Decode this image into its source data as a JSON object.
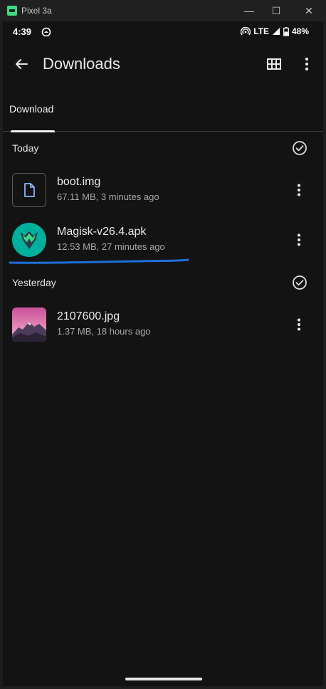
{
  "window": {
    "title": "Pixel 3a",
    "minimize_glyph": "—",
    "maximize_glyph": "☐",
    "close_glyph": "✕"
  },
  "status_bar": {
    "time": "4:39",
    "network": "LTE",
    "battery": "48%"
  },
  "app_bar": {
    "title": "Downloads"
  },
  "tabs": [
    {
      "label": "Download",
      "selected": true
    }
  ],
  "sections": [
    {
      "label": "Today",
      "items": [
        {
          "name": "boot.img",
          "meta": "67.11 MB, 3 minutes ago",
          "thumb": "file-icon"
        },
        {
          "name": "Magisk-v26.4.apk",
          "meta": "12.53 MB, 27 minutes ago",
          "thumb": "magisk-icon"
        }
      ]
    },
    {
      "label": "Yesterday",
      "items": [
        {
          "name": "2107600.jpg",
          "meta": "1.37 MB, 18 hours ago",
          "thumb": "mountain-image"
        }
      ]
    }
  ],
  "colors": {
    "background": "#131313",
    "text": "#e8e8e8",
    "subtext": "#a8a8a8",
    "annotation": "#1e6fd9",
    "magisk_bg": "#00af9c"
  }
}
